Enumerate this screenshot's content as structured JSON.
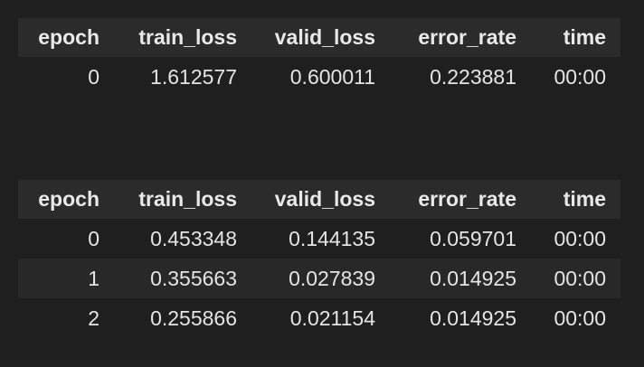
{
  "tables": [
    {
      "headers": [
        "epoch",
        "train_loss",
        "valid_loss",
        "error_rate",
        "time"
      ],
      "rows": [
        [
          "0",
          "1.612577",
          "0.600011",
          "0.223881",
          "00:00"
        ]
      ]
    },
    {
      "headers": [
        "epoch",
        "train_loss",
        "valid_loss",
        "error_rate",
        "time"
      ],
      "rows": [
        [
          "0",
          "0.453348",
          "0.144135",
          "0.059701",
          "00:00"
        ],
        [
          "1",
          "0.355663",
          "0.027839",
          "0.014925",
          "00:00"
        ],
        [
          "2",
          "0.255866",
          "0.021154",
          "0.014925",
          "00:00"
        ]
      ]
    }
  ],
  "colors": {
    "background": "#1f1f1f",
    "header_row": "#2b2b2b",
    "alt_row": "#282828",
    "text": "#e6e6e6"
  }
}
